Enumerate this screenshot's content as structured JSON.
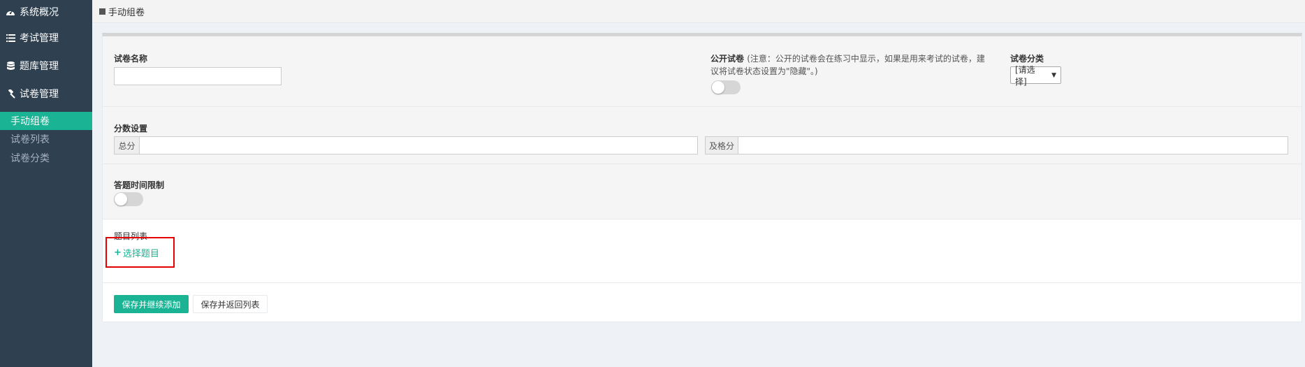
{
  "sidebar": {
    "items": [
      {
        "label": "系统概况",
        "icon": "dashboard-icon"
      },
      {
        "label": "考试管理",
        "icon": "list-icon"
      },
      {
        "label": "题库管理",
        "icon": "database-icon"
      },
      {
        "label": "试卷管理",
        "icon": "gavel-icon"
      }
    ],
    "subitems": [
      {
        "label": "手动组卷",
        "active": true
      },
      {
        "label": "试卷列表",
        "active": false
      },
      {
        "label": "试卷分类",
        "active": false
      }
    ]
  },
  "breadcrumb": {
    "label": "手动组卷"
  },
  "form": {
    "paper_name": {
      "label": "试卷名称",
      "value": "",
      "placeholder": ""
    },
    "public_paper": {
      "label": "公开试卷",
      "hint_line1": "(注意：公开的试卷会在练习中显示，如果是用来考试的试卷，建",
      "hint_line2": "议将试卷状态设置为\"隐藏\"。)",
      "enabled": false
    },
    "category": {
      "label": "试卷分类",
      "selected": "[请选择]"
    },
    "score": {
      "label": "分数设置",
      "total_label": "总分",
      "total_value": "",
      "pass_label": "及格分",
      "pass_value": ""
    },
    "time_limit": {
      "label": "答题时间限制",
      "enabled": false
    },
    "questions": {
      "label": "题目列表",
      "add_label": "选择题目"
    }
  },
  "buttons": {
    "save_continue": "保存并继续添加",
    "save_return": "保存并返回列表"
  },
  "colors": {
    "accent": "#1ab394",
    "sidebar": "#2f4050",
    "highlight": "#e60000"
  }
}
